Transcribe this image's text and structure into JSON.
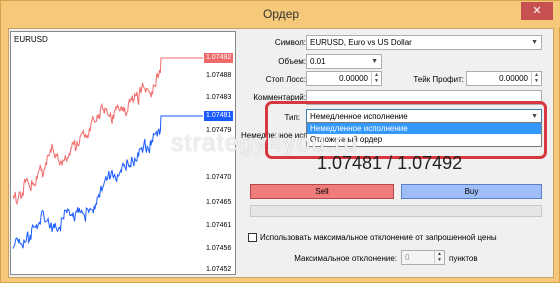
{
  "window": {
    "title": "Ордер",
    "close_glyph": "✕"
  },
  "chart": {
    "symbol": "EURUSD",
    "price_ticks": [
      "1.07479",
      "1.07470",
      "1.07465",
      "1.07461",
      "1.07456",
      "1.07452",
      "1.07488",
      "1.07483"
    ],
    "ask_tag": "1.07492",
    "bid_tag": "1.07481",
    "ask_color": "#f06a6a",
    "bid_color": "#1a5bff"
  },
  "form": {
    "symbol_label": "Символ:",
    "symbol_value": "EURUSD, Euro vs US Dollar",
    "volume_label": "Объем:",
    "volume_value": "0.01",
    "stoploss_label": "Стоп Лосс:",
    "stoploss_value": "0.00000",
    "takeprofit_label": "Тейк Профит:",
    "takeprofit_value": "0.00000",
    "comment_label": "Комментарий:",
    "comment_value": "",
    "type_label": "Тип:",
    "type_value": "Немедленное исполнение",
    "type_options": [
      "Немедленное исполнение",
      "Отложенный ордер"
    ],
    "mode_label_partial": "Немедленное испо"
  },
  "quote": {
    "bid": "1.07481",
    "separator": "/",
    "ask": "1.07492"
  },
  "buttons": {
    "sell": "Sell",
    "buy": "Buy"
  },
  "deviation": {
    "checkbox_label": "Использовать максимальное отклонение от запрошенной цены",
    "max_label": "Максимальное отклонение:",
    "max_value": "0",
    "unit": "пунктов"
  },
  "watermark": "strategy4you.ru"
}
